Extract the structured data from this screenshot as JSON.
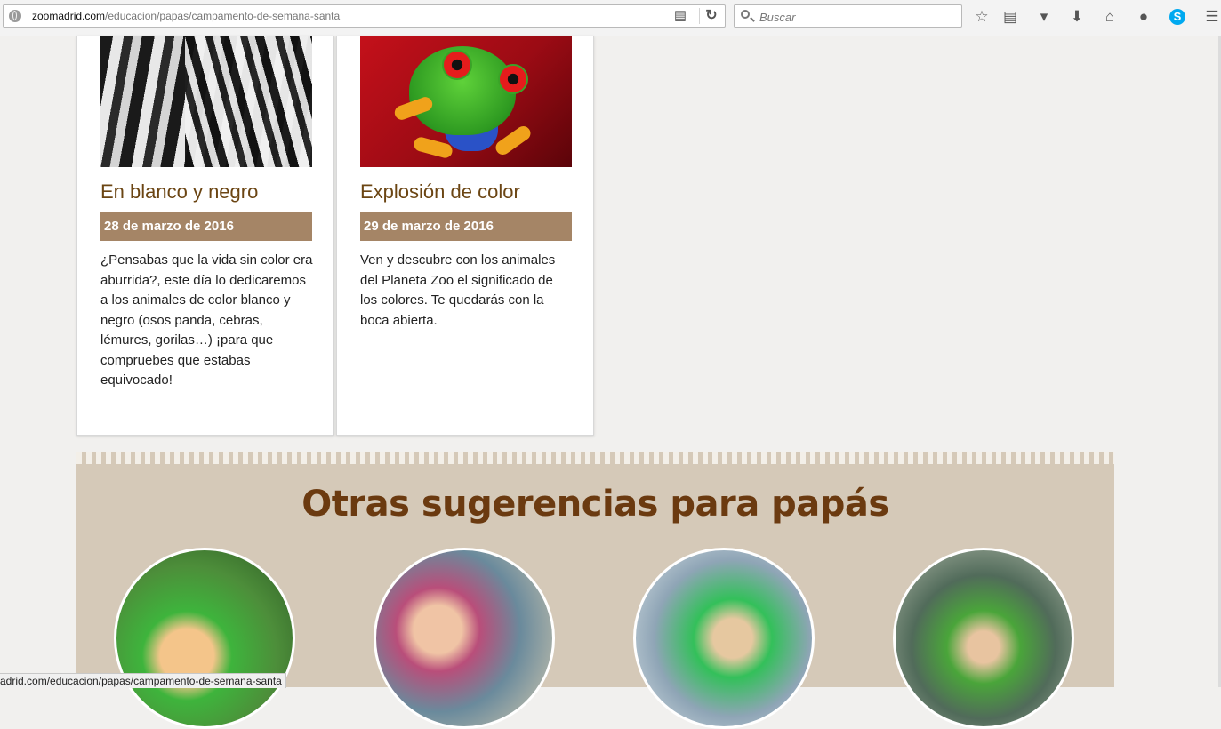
{
  "browser": {
    "url_host": "zoomadrid.com",
    "url_path": "/educacion/papas/campamento-de-semana-santa",
    "search_placeholder": "Buscar",
    "status_url": "adrid.com/educacion/papas/campamento-de-semana-santa",
    "icons": [
      "globe-icon",
      "reader-view-icon",
      "reload-icon",
      "search-icon",
      "bookmark-star-icon",
      "reading-list-icon",
      "pocket-icon",
      "download-icon",
      "home-icon",
      "chat-icon",
      "skype-icon",
      "menu-icon"
    ]
  },
  "activities": [
    {
      "title": "En blanco y negro",
      "date": "28 de marzo de 2016",
      "description": "¿Pensabas que la vida sin color era aburrida?, este día lo dedicaremos a los animales de color blanco y negro (osos panda, cebras, lémures, gorilas…) ¡para que compruebes que estabas equivocado!"
    },
    {
      "title": "Explosión de color",
      "date": "29 de marzo de 2016",
      "description": "Ven y descubre con los animales del Planeta Zoo el significado de los colores. Te quedarás con la boca abierta."
    }
  ],
  "suggestions": {
    "title": "Otras sugerencias para papás"
  },
  "colors": {
    "title_brown": "#6b4513",
    "date_band": "#a58566",
    "section_bg": "#d5c9b8",
    "section_title": "#6b3a10"
  }
}
